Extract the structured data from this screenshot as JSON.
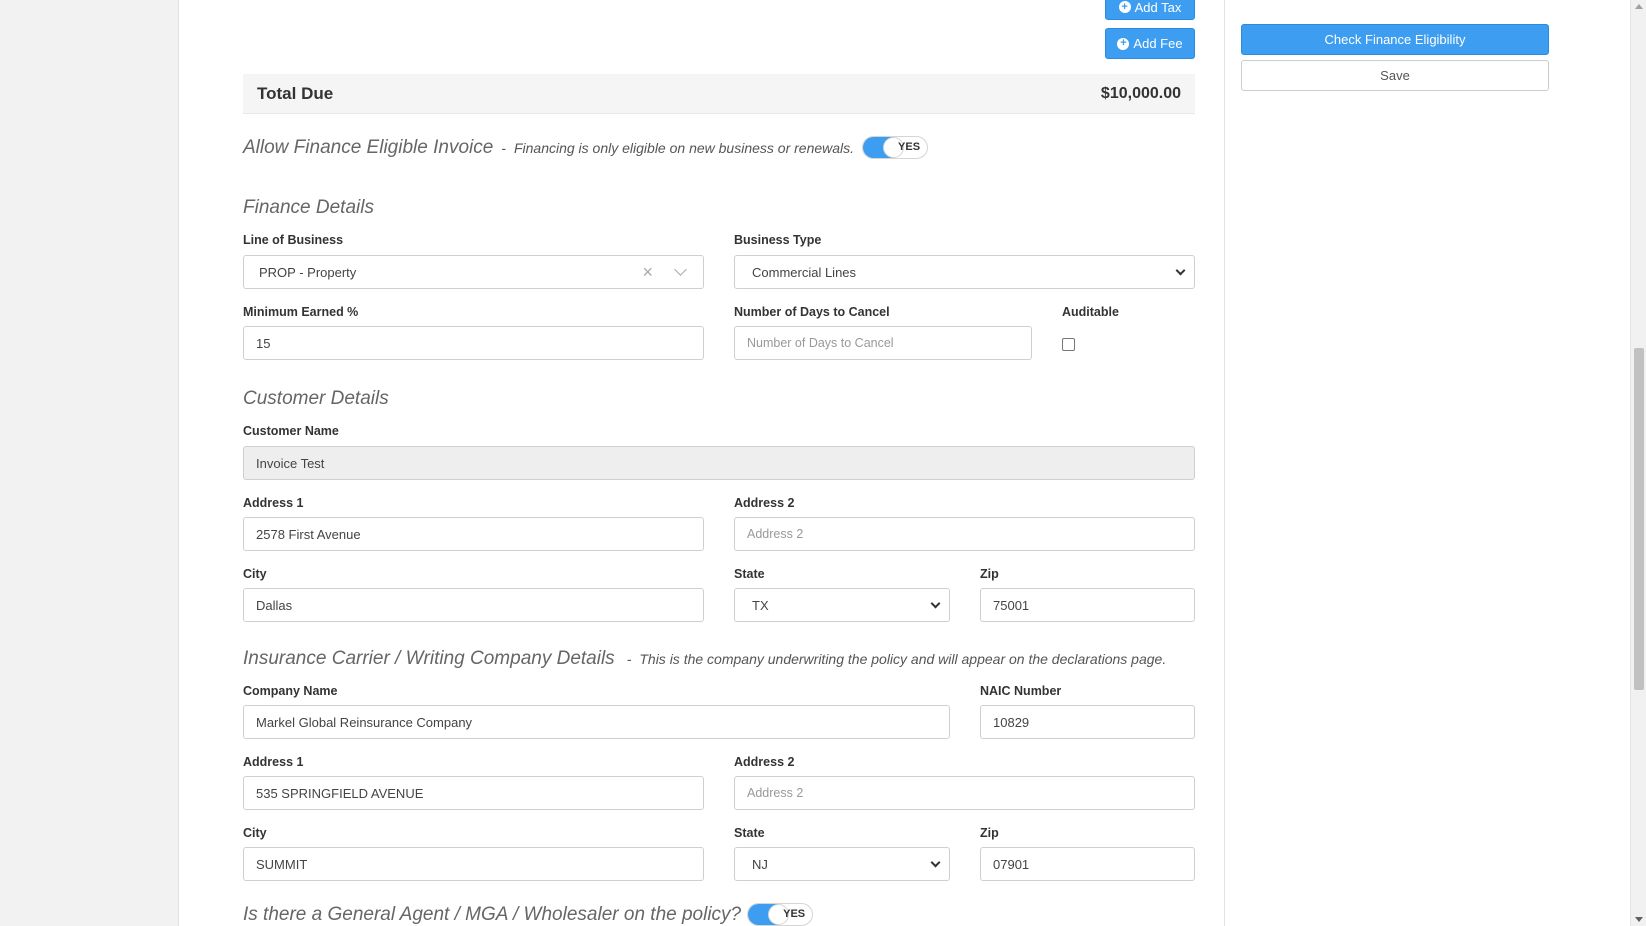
{
  "actions": {
    "add_tax_label": "Add Tax",
    "add_fee_label": "Add Fee",
    "check_eligibility_label": "Check Finance Eligibility",
    "save_label": "Save"
  },
  "total": {
    "label": "Total Due",
    "value": "$10,000.00"
  },
  "finance_toggle": {
    "heading": "Allow Finance Eligible Invoice",
    "separator": "-",
    "note": "Financing is only eligible on new business or renewals.",
    "value": "YES"
  },
  "finance_details": {
    "heading": "Finance Details",
    "line_of_business": {
      "label": "Line of Business",
      "value": "PROP - Property"
    },
    "business_type": {
      "label": "Business Type",
      "value": "Commercial Lines"
    },
    "minimum_earned": {
      "label": "Minimum Earned %",
      "value": "15"
    },
    "days_to_cancel": {
      "label": "Number of Days to Cancel",
      "placeholder": "Number of Days to Cancel"
    },
    "auditable": {
      "label": "Auditable",
      "checked": false
    }
  },
  "customer_details": {
    "heading": "Customer Details",
    "customer_name": {
      "label": "Customer Name",
      "value": "Invoice Test"
    },
    "address1": {
      "label": "Address 1",
      "value": "2578 First Avenue"
    },
    "address2": {
      "label": "Address 2",
      "placeholder": "Address 2"
    },
    "city": {
      "label": "City",
      "value": "Dallas"
    },
    "state": {
      "label": "State",
      "value": "TX"
    },
    "zip": {
      "label": "Zip",
      "value": "75001"
    }
  },
  "carrier_details": {
    "heading": "Insurance Carrier / Writing Company Details",
    "separator": "-",
    "note": "This is the company underwriting the policy and will appear on the declarations page.",
    "company_name": {
      "label": "Company Name",
      "value": "Markel Global Reinsurance Company"
    },
    "naic": {
      "label": "NAIC Number",
      "value": "10829"
    },
    "address1": {
      "label": "Address 1",
      "value": "535 SPRINGFIELD AVENUE"
    },
    "address2": {
      "label": "Address 2",
      "placeholder": "Address 2"
    },
    "city": {
      "label": "City",
      "value": "SUMMIT"
    },
    "state": {
      "label": "State",
      "value": "NJ"
    },
    "zip": {
      "label": "Zip",
      "value": "07901"
    }
  },
  "agent_toggle": {
    "heading": "Is there a General Agent / MGA / Wholesaler on the policy?",
    "value": "YES"
  },
  "colors": {
    "accent": "#3d9df0",
    "panel": "#ffffff",
    "background": "#f2f2f2"
  }
}
